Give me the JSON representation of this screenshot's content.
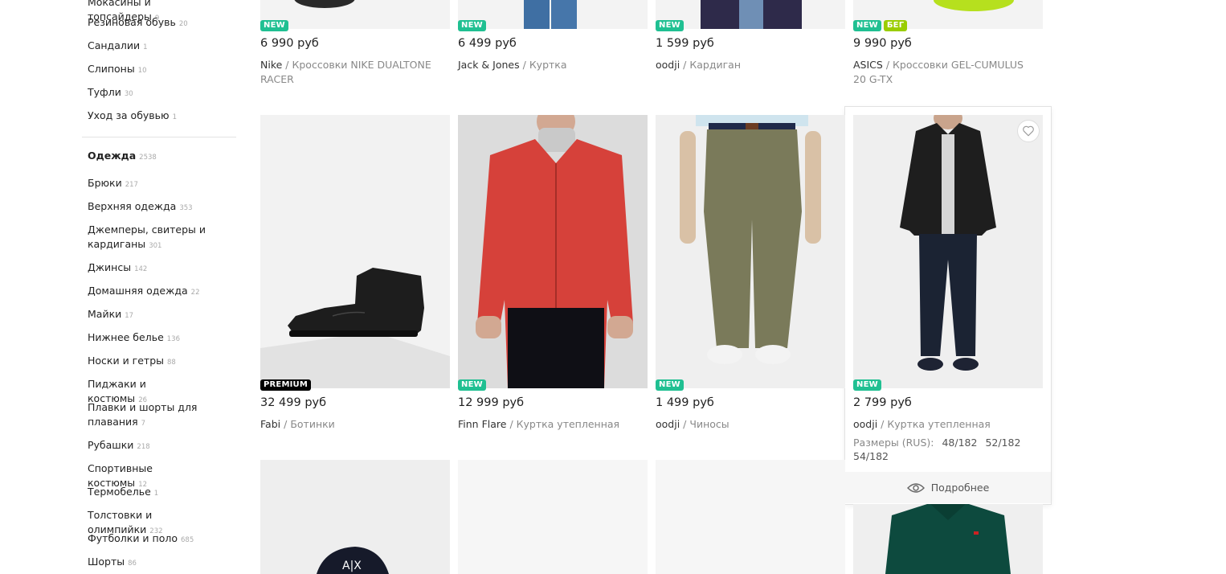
{
  "sidebar": {
    "categories_top": [
      {
        "label": "Мокасины и топсайдеры",
        "count": "9"
      },
      {
        "label": "Резиновая обувь",
        "count": "20"
      },
      {
        "label": "Сандалии",
        "count": "1"
      },
      {
        "label": "Слипоны",
        "count": "10"
      },
      {
        "label": "Туфли",
        "count": "30"
      },
      {
        "label": "Уход за обувью",
        "count": "1"
      }
    ],
    "section_title": "Одежда",
    "section_count": "2538",
    "categories": [
      {
        "label": "Брюки",
        "count": "217"
      },
      {
        "label": "Верхняя одежда",
        "count": "353"
      },
      {
        "label": "Джемперы, свитеры и кардиганы",
        "count": "301"
      },
      {
        "label": "Джинсы",
        "count": "142"
      },
      {
        "label": "Домашняя одежда",
        "count": "22"
      },
      {
        "label": "Майки",
        "count": "17"
      },
      {
        "label": "Нижнее белье",
        "count": "136"
      },
      {
        "label": "Носки и гетры",
        "count": "88"
      },
      {
        "label": "Пиджаки и костюмы",
        "count": "26"
      },
      {
        "label": "Плавки и шорты для плавания",
        "count": "7"
      },
      {
        "label": "Рубашки",
        "count": "218"
      },
      {
        "label": "Спортивные костюмы",
        "count": "12"
      },
      {
        "label": "Термобелье",
        "count": "1"
      },
      {
        "label": "Толстовки и олимпийки",
        "count": "232"
      },
      {
        "label": "Футболки и поло",
        "count": "685"
      },
      {
        "label": "Шорты",
        "count": "86"
      }
    ]
  },
  "products_row1": [
    {
      "badges": [
        "NEW"
      ],
      "price": "6 990 руб",
      "brand": "Nike",
      "name": "Кроссовки NIKE DUALTONE RACER"
    },
    {
      "badges": [
        "NEW"
      ],
      "price": "6 499 руб",
      "brand": "Jack & Jones",
      "name": "Куртка"
    },
    {
      "badges": [
        "NEW"
      ],
      "price": "1 599 руб",
      "brand": "oodji",
      "name": "Кардиган"
    },
    {
      "badges": [
        "NEW",
        "БЕГ"
      ],
      "price": "9 990 руб",
      "brand": "ASICS",
      "name": "Кроссовки GEL-CUMULUS 20 G-TX"
    }
  ],
  "products_row2": [
    {
      "badges": [
        "PREMIUM"
      ],
      "price": "32 499 руб",
      "brand": "Fabi",
      "name": "Ботинки"
    },
    {
      "badges": [
        "NEW"
      ],
      "price": "12 999 руб",
      "brand": "Finn Flare",
      "name": "Куртка утепленная"
    },
    {
      "badges": [
        "NEW"
      ],
      "price": "1 499 руб",
      "brand": "oodji",
      "name": "Чиносы"
    },
    {
      "badges": [
        "NEW"
      ],
      "price": "2 799 руб",
      "brand": "oodji",
      "name": "Куртка утепленная",
      "sizes_label": "Размеры (RUS):",
      "sizes": [
        "48/182",
        "52/182",
        "54/182"
      ],
      "details_label": "Подробнее"
    }
  ],
  "separator": "/",
  "colors": {
    "new_badge": "#20c092",
    "run_badge": "#9acd00",
    "premium_badge": "#000000"
  },
  "icons": {
    "favorite": "heart-icon",
    "details": "eye-icon"
  }
}
